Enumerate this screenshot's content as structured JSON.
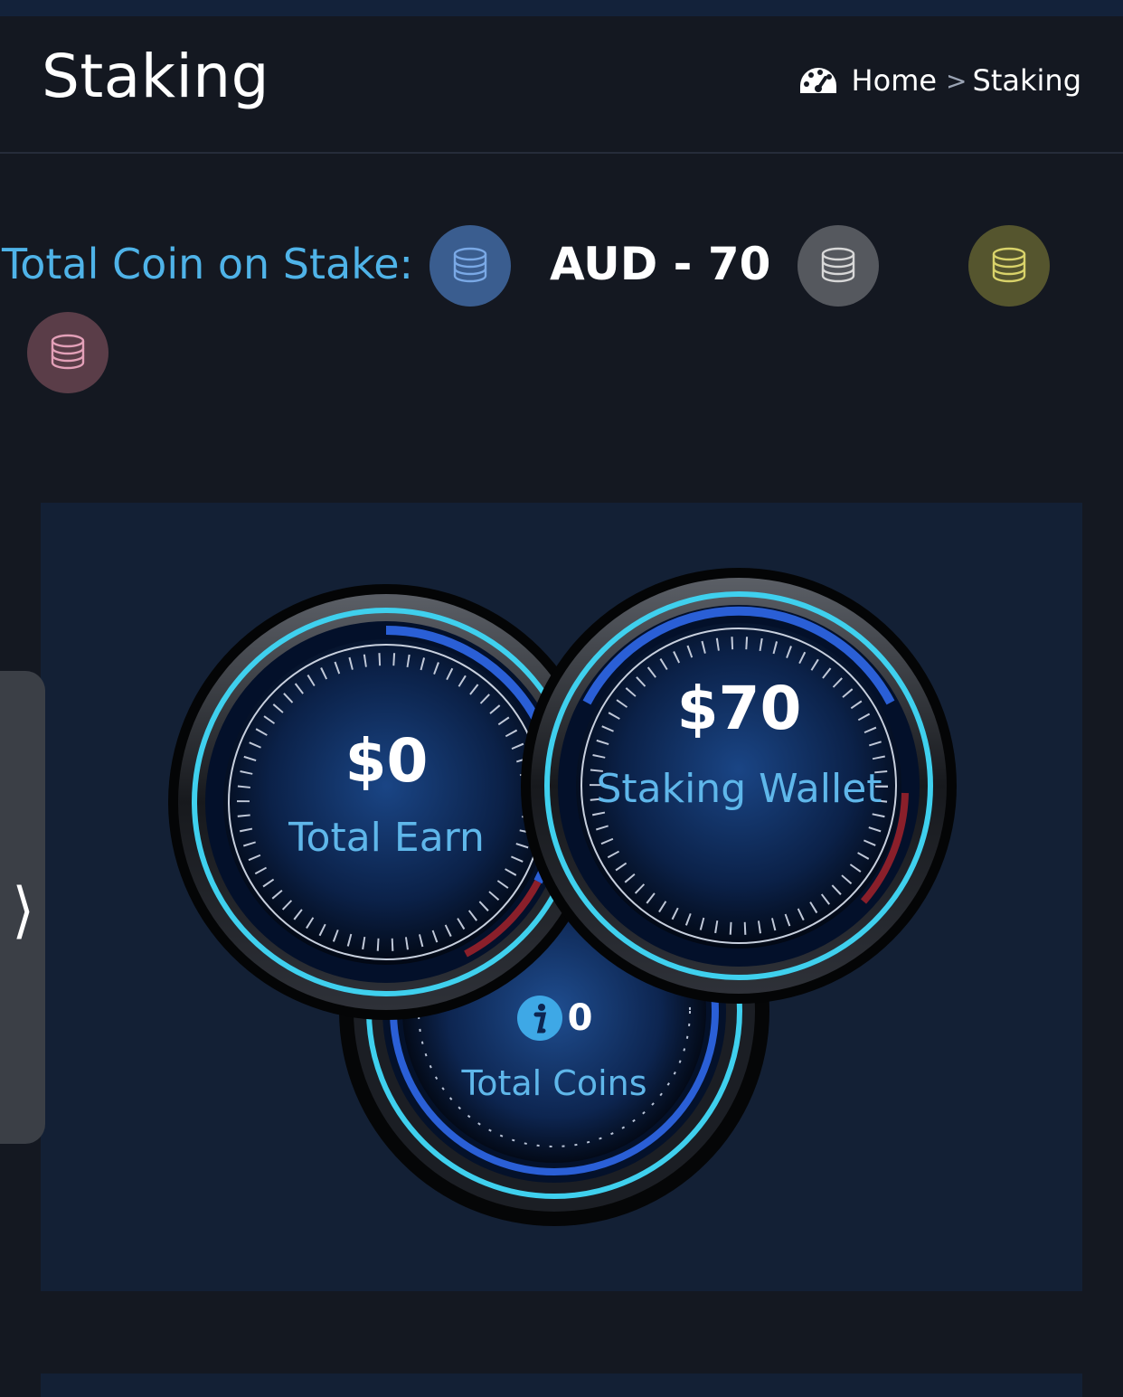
{
  "header": {
    "title": "Staking",
    "breadcrumb": {
      "home": "Home",
      "separator": ">",
      "current": "Staking"
    }
  },
  "stake": {
    "label": "Total Coin on Stake:",
    "amount": "AUD - 70",
    "coins": [
      {
        "icon": "coin-stack-icon",
        "color": "#3a5d8f"
      },
      {
        "icon": "coin-stack-icon",
        "color": "#55585e"
      },
      {
        "icon": "coin-stack-icon",
        "color": "#55552e"
      },
      {
        "icon": "coin-stack-icon",
        "color": "#5a3d48"
      }
    ]
  },
  "gauges": {
    "earn": {
      "value": "$0",
      "label": "Total Earn"
    },
    "wallet": {
      "value": "$70",
      "label": "Staking Wallet",
      "icon": "wallet-icon"
    },
    "coins": {
      "value": "0",
      "label": "Total Coins",
      "icon": "info-icon"
    }
  },
  "sidebar_toggle": {
    "glyph": "❭"
  },
  "colors": {
    "background": "#141821",
    "panel": "#132035",
    "accent": "#4fb3e8",
    "gauge_ring": "#3fd0ee"
  }
}
